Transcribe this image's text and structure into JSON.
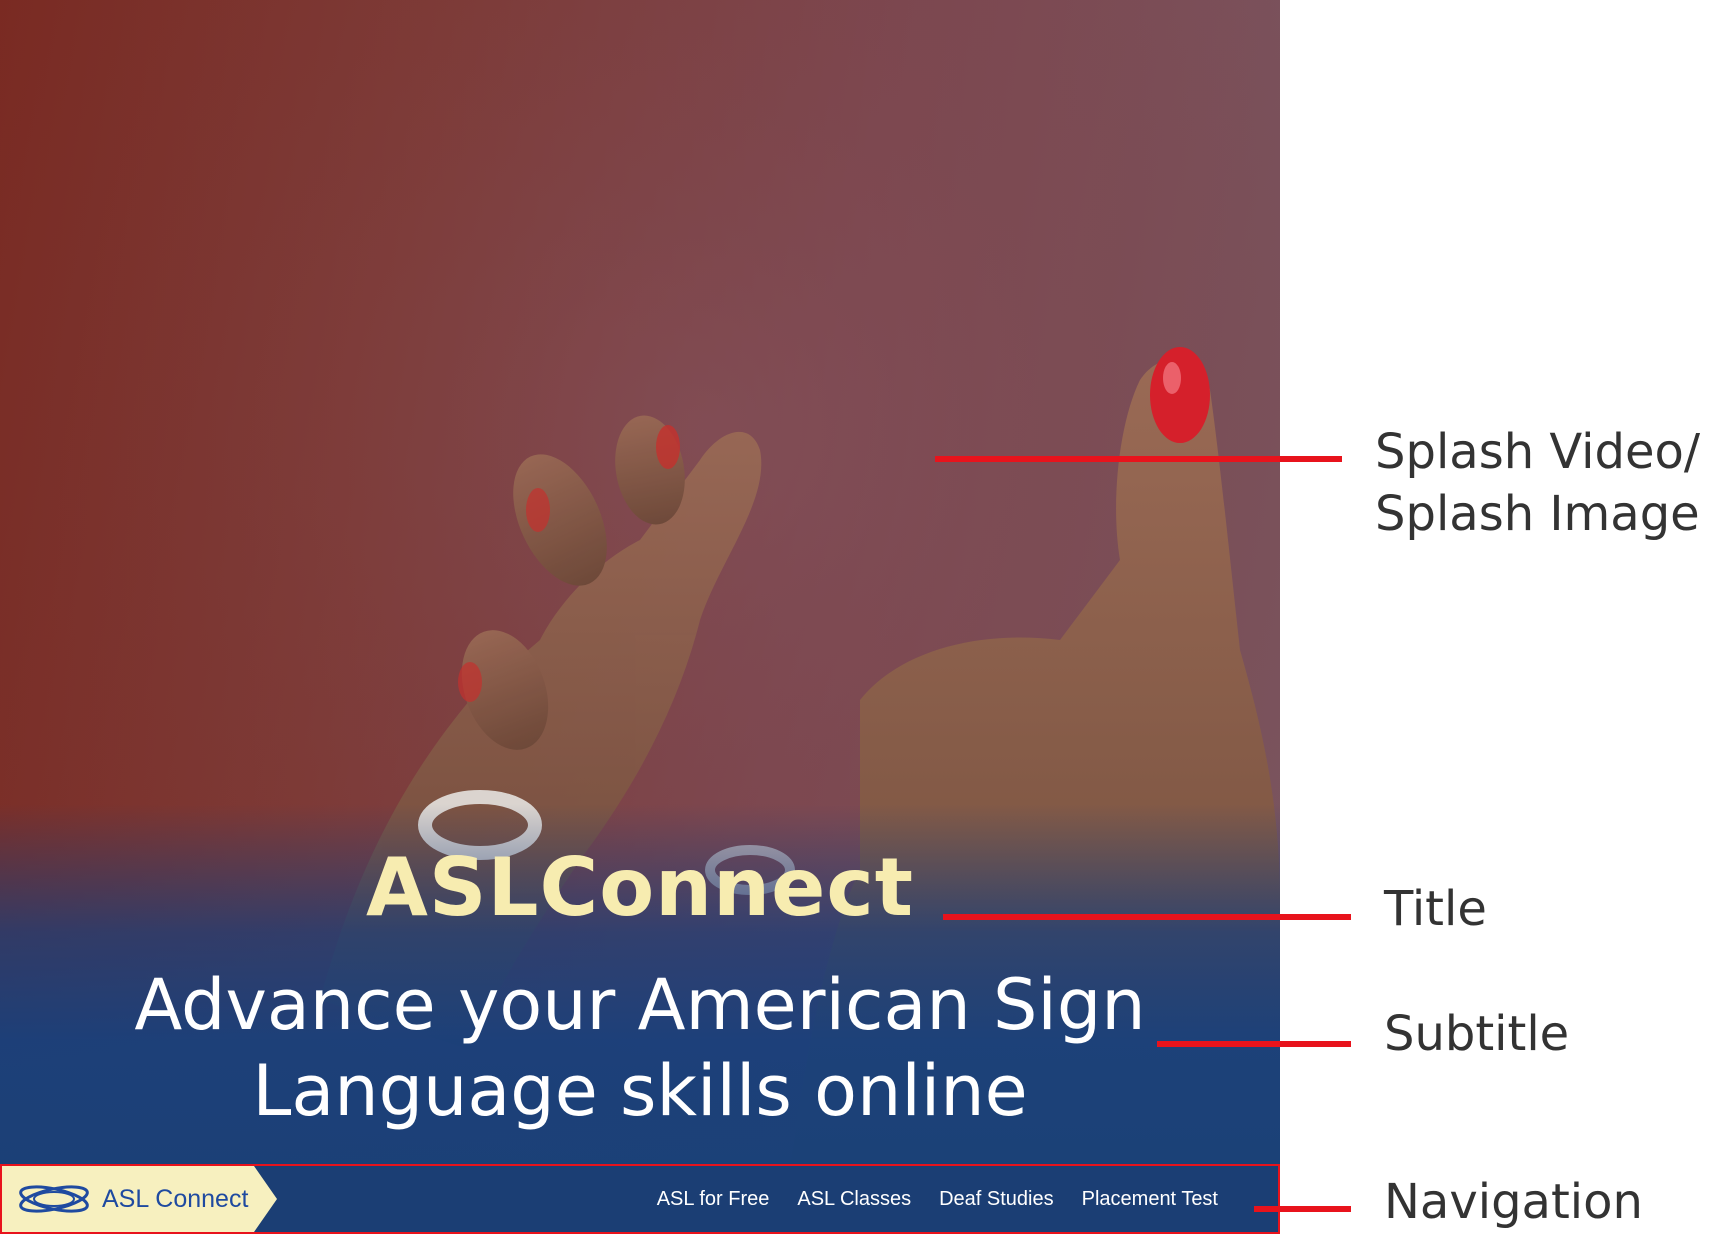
{
  "hero": {
    "title": "ASLConnect",
    "subtitle": "Advance your American Sign Language skills online"
  },
  "navbar": {
    "logo_text": "ASL Connect",
    "logo_icon": "interlinked-rings-logo-icon",
    "links": [
      {
        "label": "ASL for Free"
      },
      {
        "label": "ASL Classes"
      },
      {
        "label": "Deaf Studies"
      },
      {
        "label": "Placement Test"
      }
    ]
  },
  "annotations": {
    "splash_line1": "Splash Video/",
    "splash_line2": "Splash Image",
    "title": "Title",
    "subtitle": "Subtitle",
    "navigation": "Navigation"
  },
  "colors": {
    "title": "#f7ecb0",
    "navbar_bg": "#1b3e74",
    "logo_bg": "#f7f0bf",
    "callout": "#e8131c"
  }
}
